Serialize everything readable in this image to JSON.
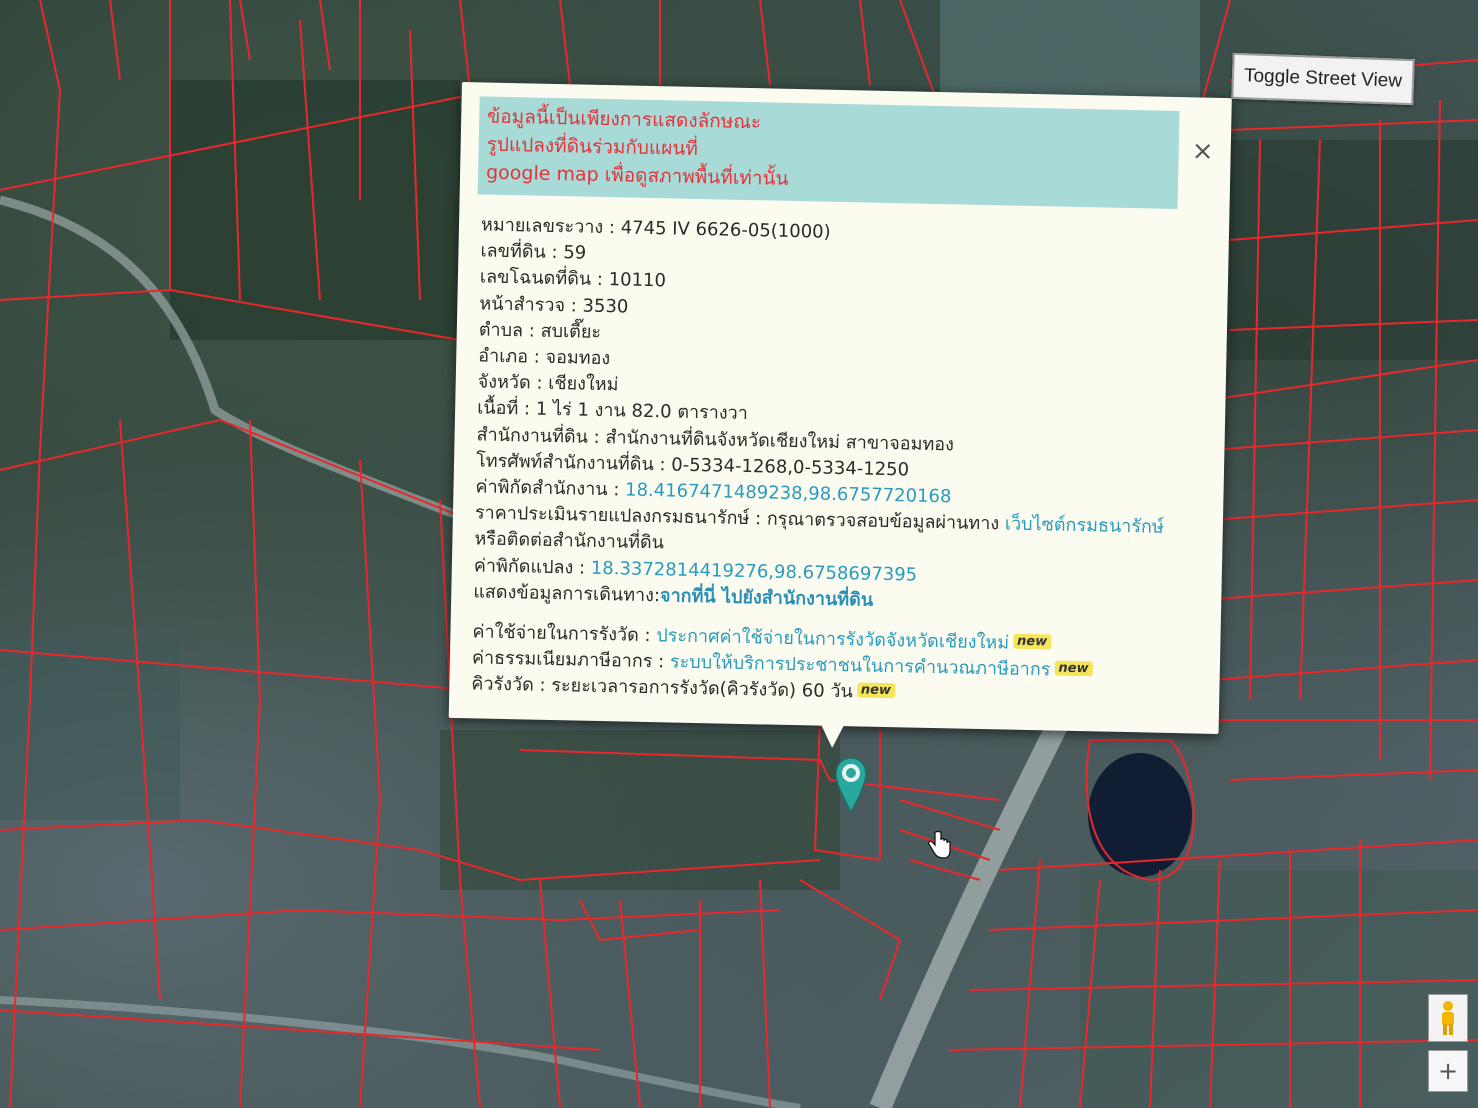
{
  "controls": {
    "toggle_street_view": "Toggle Street View",
    "zoom_in": "+",
    "close": "×"
  },
  "popup": {
    "disclaimer": [
      "ข้อมูลนี้เป็นเพียงการแสดงลักษณะ",
      "รูปแปลงที่ดินร่วมกับแผนที่",
      "google map เพื่อดูสภาพพื้นที่เท่านั้น"
    ],
    "rows": [
      {
        "label": "หมายเลขระวาง :",
        "value": "4745 IV 6626-05(1000)"
      },
      {
        "label": "เลขที่ดิน :",
        "value": "59"
      },
      {
        "label": "เลขโฉนดที่ดิน :",
        "value": "10110"
      },
      {
        "label": "หน้าสำรวจ :",
        "value": "3530"
      },
      {
        "label": "ตำบล :",
        "value": "สบเตี๊ยะ"
      },
      {
        "label": "อำเภอ :",
        "value": "จอมทอง"
      },
      {
        "label": "จังหวัด :",
        "value": "เชียงใหม่"
      },
      {
        "label": "เนื้อที่ :",
        "value": "1 ไร่ 1 งาน 82.0 ตารางวา"
      },
      {
        "label": "สำนักงานที่ดิน :",
        "value": "สำนักงานที่ดินจังหวัดเชียงใหม่ สาขาจอมทอง"
      },
      {
        "label": "โทรศัพท์สำนักงานที่ดิน :",
        "value": "0-5334-1268,0-5334-1250"
      }
    ],
    "office_coords_label": "ค่าพิกัดสำนักงาน :",
    "office_coords": "18.4167471489238,98.6757720168",
    "appraisal_label": "ราคาประเมินรายแปลงกรมธนารักษ์ :",
    "appraisal_text": "กรุณาตรวจสอบข้อมูลผ่านทาง",
    "appraisal_link": "เว็บไซต์กรมธนารักษ์",
    "appraisal_contact": "หรือติดต่อสำนักงานที่ดิน",
    "parcel_coords_label": "ค่าพิกัดแปลง :",
    "parcel_coords": "18.3372814419276,98.6758697395",
    "directions_label": "แสดงข้อมูลการเดินทาง:",
    "directions_link": "จากที่นี่ ไปยังสำนักงานที่ดิน",
    "fee_label": "ค่าใช้จ่ายในการรังวัด :",
    "fee_link": "ประกาศค่าใช้จ่ายในการรังวัดจังหวัดเชียงใหม่",
    "tax_label": "ค่าธรรมเนียมภาษีอากร :",
    "tax_link": "ระบบให้บริการประชาชนในการคำนวณภาษีอากร",
    "queue_label": "คิวรังวัด :",
    "queue_value": "ระยะเวลารอการรังวัด(คิวรังวัด) 60 วัน",
    "new_badge": "new"
  }
}
